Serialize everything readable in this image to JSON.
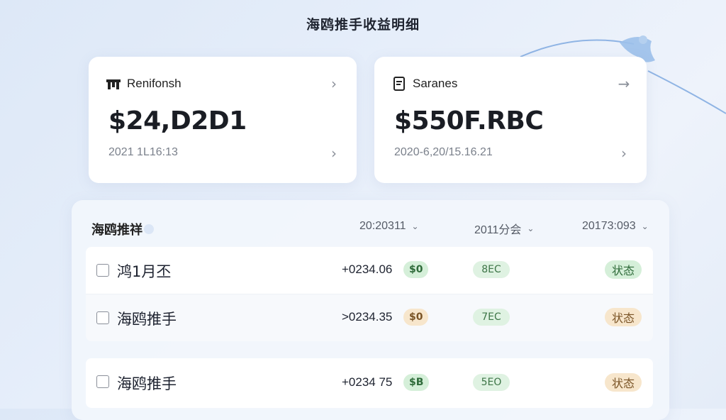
{
  "page": {
    "title": "海鸥推手收益明细"
  },
  "cards": [
    {
      "icon": "building-icon",
      "label": "Renifonsh",
      "amount": "$24,D2D1",
      "date": "2021 1L16:13"
    },
    {
      "icon": "document-icon",
      "label": "Saranes",
      "amount": "$550F.RBC",
      "date": "2020-6,20/15.16.21"
    }
  ],
  "table": {
    "title": "海鸥推祥",
    "columns": [
      "20:20311",
      "2011分会",
      "20173:093"
    ],
    "rows": [
      {
        "name": "鸿1月丕",
        "amount": "+0234.06",
        "amount_tag": "$0",
        "mid_tag": "8EC",
        "status": "状态",
        "status_color": "green"
      },
      {
        "name": "海鸥推手",
        "amount": ">0234.35",
        "amount_tag": "$0",
        "mid_tag": "7EC",
        "status": "状态",
        "status_color": "orange"
      },
      {
        "name": "海鸥推手",
        "amount": "+0234 75",
        "amount_tag": "$B",
        "mid_tag": "5EO",
        "status": "状态",
        "status_color": "orange"
      }
    ]
  },
  "colors": {
    "green": "#d5efd9",
    "orange": "#f7e6cc",
    "accent": "#6f9fd8"
  }
}
